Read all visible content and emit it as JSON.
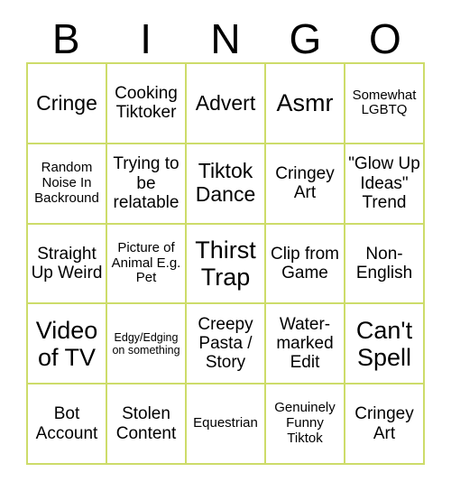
{
  "header": {
    "letters": [
      "B",
      "I",
      "N",
      "G",
      "O"
    ]
  },
  "grid": {
    "border_color": "#cddc6a",
    "background_color": "#ffffff",
    "text_color": "#000000",
    "columns": 5,
    "rows": 5,
    "cells": [
      {
        "text": "Cringe",
        "size": "lg"
      },
      {
        "text": "Cooking Tiktoker",
        "size": "md"
      },
      {
        "text": "Advert",
        "size": "lg"
      },
      {
        "text": "Asmr",
        "size": "xl"
      },
      {
        "text": "Somewhat LGBTQ",
        "size": "sm"
      },
      {
        "text": "Random Noise In Backround",
        "size": "sm"
      },
      {
        "text": "Trying to be relatable",
        "size": "md"
      },
      {
        "text": "Tiktok Dance",
        "size": "lg"
      },
      {
        "text": "Cringey Art",
        "size": "md"
      },
      {
        "text": "\"Glow Up Ideas\" Trend",
        "size": "md"
      },
      {
        "text": "Straight Up Weird",
        "size": "md"
      },
      {
        "text": "Picture of Animal E.g. Pet",
        "size": "sm"
      },
      {
        "text": "Thirst Trap",
        "size": "xl"
      },
      {
        "text": "Clip from Game",
        "size": "md"
      },
      {
        "text": "Non-English",
        "size": "md"
      },
      {
        "text": "Video of TV",
        "size": "xl"
      },
      {
        "text": "Edgy/Edging on something",
        "size": "xs"
      },
      {
        "text": "Creepy Pasta / Story",
        "size": "md"
      },
      {
        "text": "Water-marked Edit",
        "size": "md"
      },
      {
        "text": "Can't Spell",
        "size": "xl"
      },
      {
        "text": "Bot Account",
        "size": "md"
      },
      {
        "text": "Stolen Content",
        "size": "md"
      },
      {
        "text": "Equestrian",
        "size": "sm"
      },
      {
        "text": "Genuinely Funny Tiktok",
        "size": "sm"
      },
      {
        "text": "Cringey Art",
        "size": "md"
      }
    ]
  }
}
